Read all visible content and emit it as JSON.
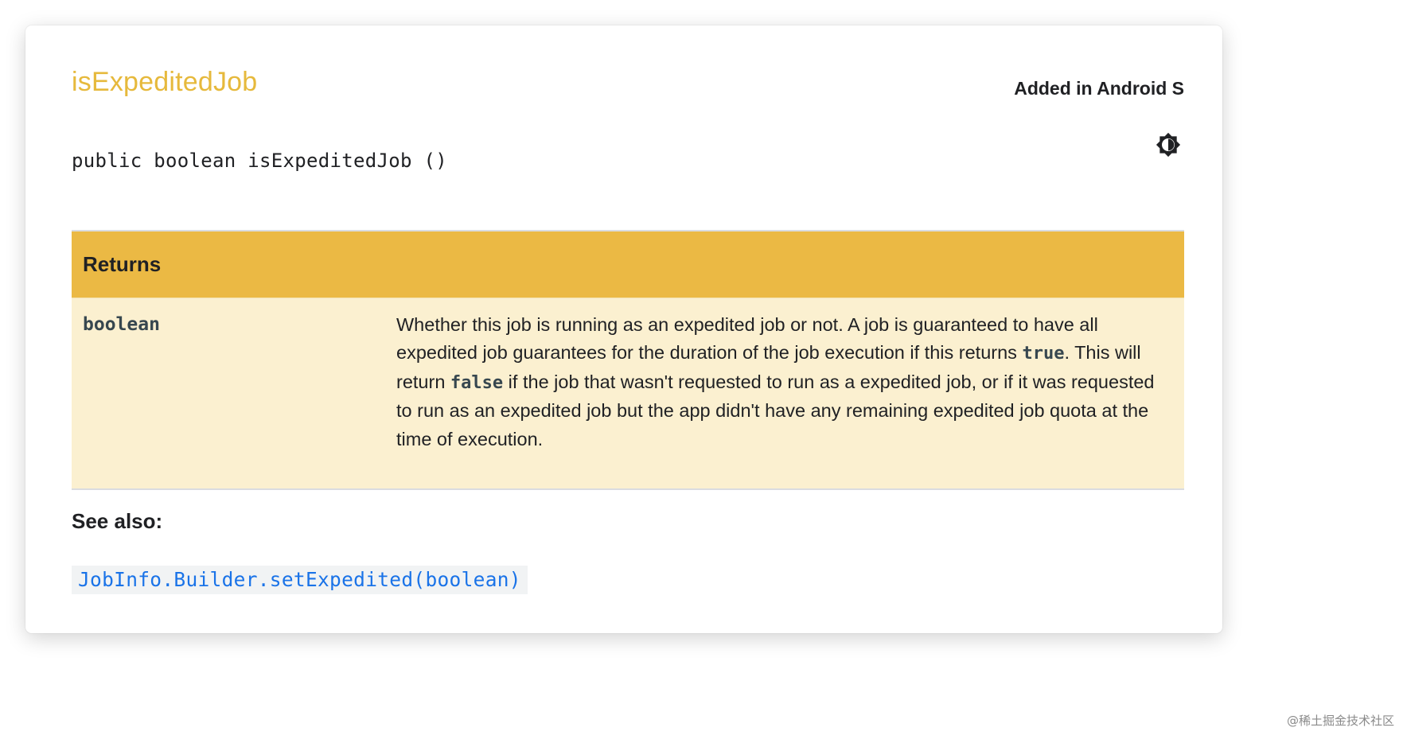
{
  "method": {
    "name": "isExpeditedJob",
    "added_in": "Added in Android S",
    "signature": "public boolean isExpeditedJob ()"
  },
  "theme_toggle": {
    "icon": "brightness-contrast-icon"
  },
  "returns": {
    "header": "Returns",
    "type": "boolean",
    "description": {
      "part1": "Whether this job is running as an expedited job or not. A job is guaranteed to have all expedited job guarantees for the duration of the job execution if this returns ",
      "code_true": "true",
      "part2": ". This will return ",
      "code_false": "false",
      "part3": " if the job that wasn't requested to run as a expedited job, or if it was requested to run as an expedited job but the app didn't have any remaining expedited job quota at the time of execution."
    }
  },
  "see_also": {
    "heading": "See also:",
    "link": "JobInfo.Builder.setExpedited(boolean)"
  },
  "watermark": "@稀土掘金技术社区",
  "colors": {
    "title": "#e6b93c",
    "table_header_bg": "#ebb944",
    "table_body_bg": "#fbf0d0",
    "link": "#1a73e8"
  }
}
